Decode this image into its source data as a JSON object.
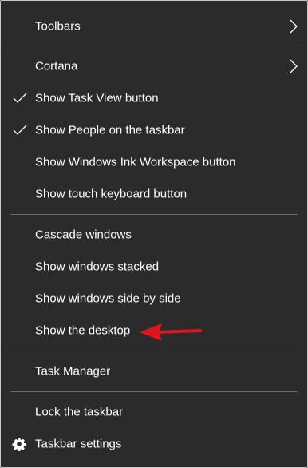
{
  "menu": {
    "toolbars": "Toolbars",
    "cortana": "Cortana",
    "show_task_view": "Show Task View button",
    "show_people": "Show People on the taskbar",
    "show_ink_workspace": "Show Windows Ink Workspace button",
    "show_touch_keyboard": "Show touch keyboard button",
    "cascade_windows": "Cascade windows",
    "show_stacked": "Show windows stacked",
    "show_side_by_side": "Show windows side by side",
    "show_desktop": "Show the desktop",
    "task_manager": "Task Manager",
    "lock_taskbar": "Lock the taskbar",
    "taskbar_settings": "Taskbar settings"
  },
  "colors": {
    "background": "#2b2b2b",
    "text": "#ffffff",
    "separator": "#6b6b6b",
    "annotation_arrow": "#e0141e"
  },
  "icons": {
    "submenu": "chevron-right-icon",
    "checked": "checkmark-icon",
    "settings": "gear-icon",
    "annotation": "red-arrow-icon"
  }
}
